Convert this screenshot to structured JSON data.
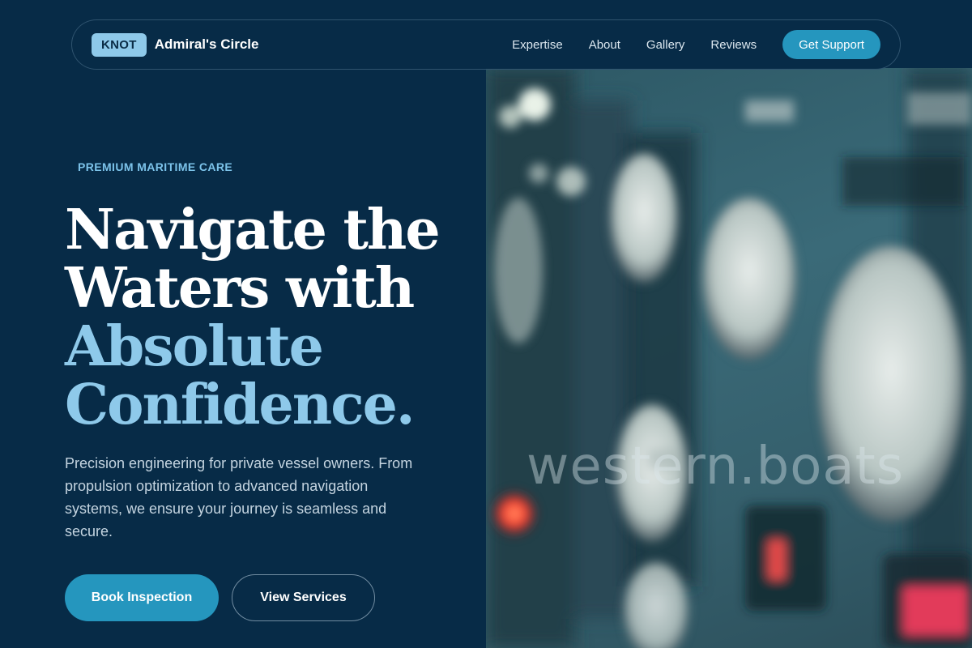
{
  "brand": {
    "badge": "KNOT",
    "name": "Admiral's Circle"
  },
  "nav": {
    "links": [
      "Expertise",
      "About",
      "Gallery",
      "Reviews"
    ],
    "cta": "Get Support"
  },
  "hero": {
    "eyebrow": "PREMIUM MARITIME CARE",
    "headline_white_1": "Navigate the",
    "headline_white_2": "Waters with",
    "headline_accent_1": "Absolute",
    "headline_accent_2": "Confidence.",
    "description": "Precision engineering for private vessel owners. From propulsion optimization to advanced navigation systems, we ensure your journey is seamless and secure.",
    "primary_button": "Book Inspection",
    "secondary_button": "View Services"
  },
  "image": {
    "watermark": "western.boats",
    "subject": "blurred-gauge-panel-photo"
  },
  "colors": {
    "background": "#072b47",
    "accent_light": "#8ec9ea",
    "accent_button": "#2596be",
    "eyebrow": "#7cc3ea"
  }
}
